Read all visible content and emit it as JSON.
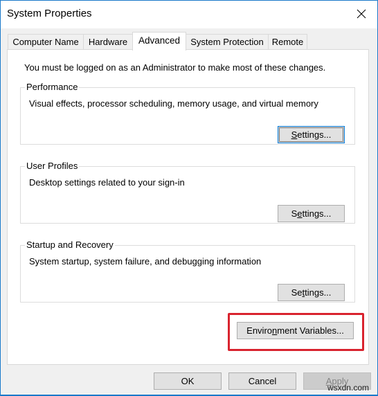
{
  "window": {
    "title": "System Properties",
    "close_icon": "close-icon",
    "accent_color": "#1979ca"
  },
  "tabs": [
    {
      "label": "Computer Name",
      "selected": false
    },
    {
      "label": "Hardware",
      "selected": false
    },
    {
      "label": "Advanced",
      "selected": true
    },
    {
      "label": "System Protection",
      "selected": false
    },
    {
      "label": "Remote",
      "selected": false
    }
  ],
  "advanced": {
    "admin_note": "You must be logged on as an Administrator to make most of these changes.",
    "groups": [
      {
        "title": "Performance",
        "description": "Visual effects, processor scheduling, memory usage, and virtual memory",
        "button": {
          "pre": "",
          "mnemonic": "S",
          "post": "ettings...",
          "label": "Settings..."
        }
      },
      {
        "title": "User Profiles",
        "description": "Desktop settings related to your sign-in",
        "button": {
          "pre": "S",
          "mnemonic": "e",
          "post": "ttings...",
          "label": "Settings..."
        }
      },
      {
        "title": "Startup and Recovery",
        "description": "System startup, system failure, and debugging information",
        "button": {
          "pre": "Se",
          "mnemonic": "t",
          "post": "tings...",
          "label": "Settings..."
        }
      }
    ],
    "env_button": {
      "pre": "Enviro",
      "mnemonic": "n",
      "post": "ment Variables...",
      "label": "Environment Variables..."
    },
    "highlight_color": "#d9232e"
  },
  "footer": {
    "ok": "OK",
    "cancel": "Cancel",
    "apply": {
      "pre": "",
      "mnemonic": "A",
      "post": "pply",
      "label": "Apply",
      "disabled": true
    }
  },
  "watermark": "wsxdn.com"
}
